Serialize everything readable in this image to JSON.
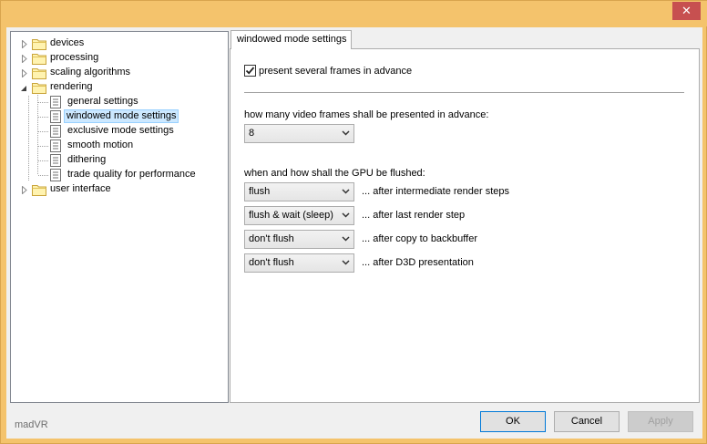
{
  "window": {
    "close_glyph": "✕",
    "app_name": "madVR"
  },
  "tree": {
    "items": [
      {
        "label": "devices",
        "type": "folder",
        "expander": "collapsed"
      },
      {
        "label": "processing",
        "type": "folder",
        "expander": "collapsed"
      },
      {
        "label": "scaling algorithms",
        "type": "folder",
        "expander": "collapsed"
      },
      {
        "label": "rendering",
        "type": "folder",
        "expander": "expanded"
      },
      {
        "label": "general settings",
        "type": "page"
      },
      {
        "label": "windowed mode settings",
        "type": "page",
        "selected": true
      },
      {
        "label": "exclusive mode settings",
        "type": "page"
      },
      {
        "label": "smooth motion",
        "type": "page"
      },
      {
        "label": "dithering",
        "type": "page"
      },
      {
        "label": "trade quality for performance",
        "type": "page"
      },
      {
        "label": "user interface",
        "type": "folder",
        "expander": "collapsed"
      }
    ]
  },
  "tab": {
    "label": "windowed mode settings"
  },
  "settings": {
    "present_advance": {
      "label": "present several frames in advance",
      "checked": true
    },
    "frames_question": "how many video frames shall be presented in advance:",
    "frames_value": "8",
    "flush_question": "when and how shall the GPU be flushed:",
    "flush_rows": [
      {
        "value": "flush",
        "desc": "... after intermediate render steps"
      },
      {
        "value": "flush & wait (sleep)",
        "desc": "... after last render step"
      },
      {
        "value": "don't flush",
        "desc": "... after copy to backbuffer"
      },
      {
        "value": "don't flush",
        "desc": "... after D3D presentation"
      }
    ]
  },
  "buttons": {
    "ok": "OK",
    "cancel": "Cancel",
    "apply": "Apply"
  },
  "colors": {
    "selection_bg": "#cce8ff",
    "selection_border": "#99d1ff",
    "close_red": "#c75050",
    "window_frame": "#f4c36c"
  }
}
